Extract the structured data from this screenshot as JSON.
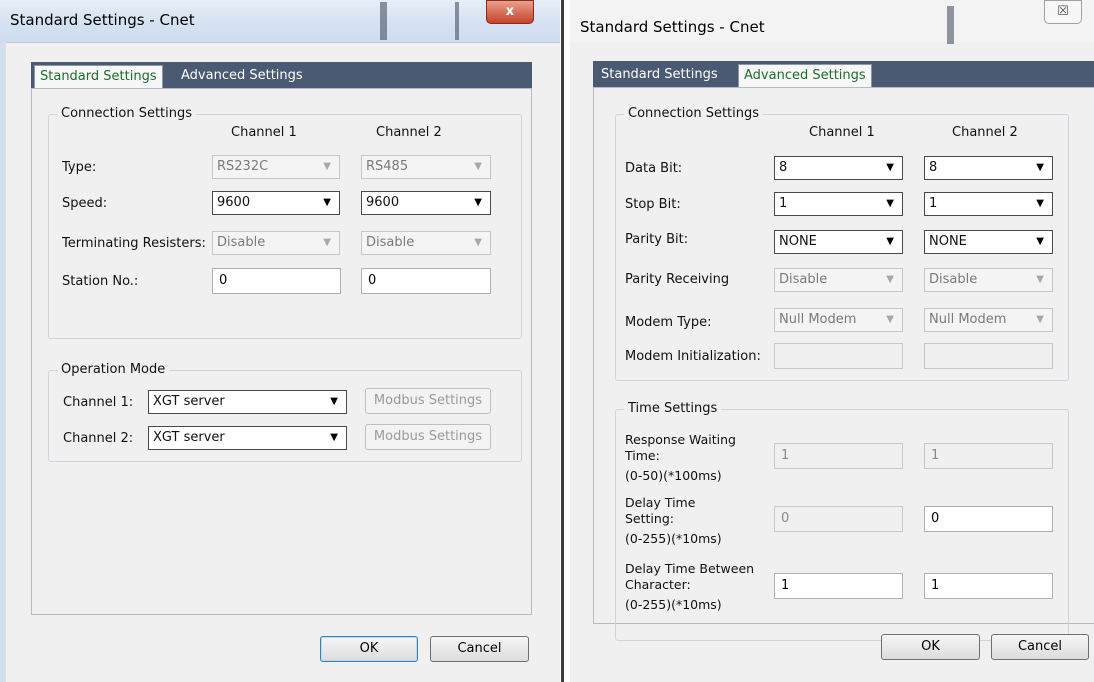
{
  "left": {
    "title": "Standard Settings - Cnet",
    "close_glyph": "x",
    "tabs": [
      "Standard Settings",
      "Advanced Settings"
    ],
    "connection_group": "Connection Settings",
    "col1": "Channel 1",
    "col2": "Channel 2",
    "rows": {
      "type": {
        "label": "Type:",
        "ch1": "RS232C",
        "ch2": "RS485"
      },
      "speed": {
        "label": "Speed:",
        "ch1": "9600",
        "ch2": "9600"
      },
      "term": {
        "label": "Terminating Resisters:",
        "ch1": "Disable",
        "ch2": "Disable"
      },
      "station": {
        "label": "Station No.:",
        "ch1": "0",
        "ch2": "0"
      }
    },
    "operation_group": "Operation Mode",
    "op1_label": "Channel 1:",
    "op1_value": "XGT server",
    "op2_label": "Channel 2:",
    "op2_value": "XGT server",
    "modbus_label": "Modbus Settings",
    "ok_label": "OK",
    "cancel_label": "Cancel"
  },
  "right": {
    "title": "Standard Settings - Cnet",
    "close_glyph": "☒",
    "tabs": [
      "Standard Settings",
      "Advanced Settings"
    ],
    "connection_group": "Connection Settings",
    "col1": "Channel 1",
    "col2": "Channel 2",
    "rows": {
      "data_bit": {
        "label": "Data Bit:",
        "ch1": "8",
        "ch2": "8"
      },
      "stop_bit": {
        "label": "Stop Bit:",
        "ch1": "1",
        "ch2": "1"
      },
      "parity_bit": {
        "label": "Parity Bit:",
        "ch1": "NONE",
        "ch2": "NONE"
      },
      "parity_recv": {
        "label": "Parity Receiving",
        "ch1": "Disable",
        "ch2": "Disable"
      },
      "modem_type": {
        "label": "Modem Type:",
        "ch1": "Null Modem",
        "ch2": "Null Modem"
      },
      "modem_init": {
        "label": "Modem Initialization:",
        "ch1": "",
        "ch2": ""
      }
    },
    "time_group": "Time Settings",
    "time_rows": {
      "response": {
        "line1": "Response Waiting",
        "line2": "Time:",
        "line3": "(0-50)(*100ms)",
        "ch1": "1",
        "ch2": "1"
      },
      "delay": {
        "line1": "Delay Time",
        "line2": "Setting:",
        "line3": "(0-255)(*10ms)",
        "ch1": "0",
        "ch2": "0"
      },
      "delay_char": {
        "line1": "Delay Time Between",
        "line2": "Character:",
        "line3": "(0-255)(*10ms)",
        "ch1": "1",
        "ch2": "1"
      }
    },
    "ok_label": "OK",
    "cancel_label": "Cancel"
  }
}
